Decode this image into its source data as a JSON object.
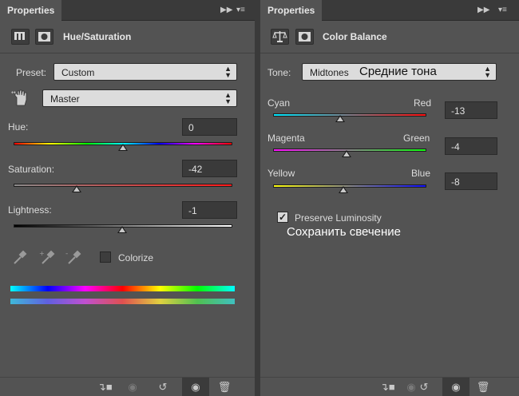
{
  "left_panel": {
    "tab_title": "Properties",
    "header_title": "Hue/Saturation",
    "preset": {
      "label": "Preset:",
      "value": "Custom"
    },
    "channel": {
      "value": "Master"
    },
    "hue": {
      "label": "Hue:",
      "value": "0",
      "level": 0.5
    },
    "saturation": {
      "label": "Saturation:",
      "value": "-42",
      "level": 0.29
    },
    "lightness": {
      "label": "Lightness:",
      "value": "-1",
      "level": 0.495
    },
    "colorize": {
      "label": "Colorize",
      "checked": false
    }
  },
  "right_panel": {
    "tab_title": "Properties",
    "header_title": "Color Balance",
    "tone": {
      "label": "Tone:",
      "value": "Midtones",
      "annotation": "Средние тона"
    },
    "sliders": [
      {
        "left": "Cyan",
        "right": "Red",
        "value": "-13",
        "level": 0.435
      },
      {
        "left": "Magenta",
        "right": "Green",
        "value": "-4",
        "level": 0.48
      },
      {
        "left": "Yellow",
        "right": "Blue",
        "value": "-8",
        "level": 0.46
      }
    ],
    "preserve_luminosity": {
      "label": "Preserve Luminosity",
      "checked": true,
      "annotation": "Сохранить свечение"
    }
  },
  "colors": {
    "panel_bg": "#535353",
    "tab_bar_bg": "#3a3a3a",
    "input_bg": "#3a3a3a",
    "dropdown_bg": "#dcdcdc"
  }
}
